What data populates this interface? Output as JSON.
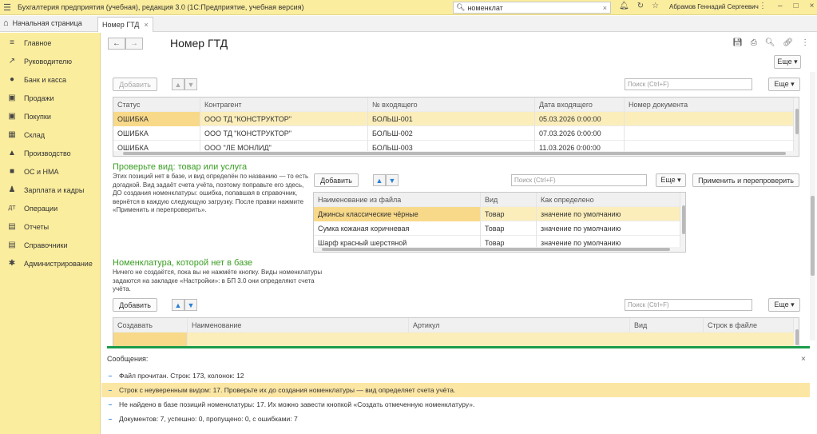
{
  "titlebar": {
    "app_title": "Бухгалтерия предприятия (учебная), редакция 3.0  (1С:Предприятие, учебная версия)",
    "search_value": "номенклат",
    "user": "Абрамов Геннадий Сергеевич"
  },
  "tabs": {
    "home": "Начальная страница",
    "doc": "Номер ГТД"
  },
  "sidebar": {
    "items": [
      {
        "label": "Главное",
        "icon": "≡"
      },
      {
        "label": "Руководителю",
        "icon": "↗"
      },
      {
        "label": "Банк и касса",
        "icon": "●"
      },
      {
        "label": "Продажи",
        "icon": "▣"
      },
      {
        "label": "Покупки",
        "icon": "▣"
      },
      {
        "label": "Склад",
        "icon": "▦"
      },
      {
        "label": "Производство",
        "icon": "▲"
      },
      {
        "label": "ОС и НМА",
        "icon": "■"
      },
      {
        "label": "Зарплата и кадры",
        "icon": "♟"
      },
      {
        "label": "Операции",
        "icon": "ДТ"
      },
      {
        "label": "Отчеты",
        "icon": "▤"
      },
      {
        "label": "Справочники",
        "icon": "▤"
      },
      {
        "label": "Администрирование",
        "icon": "✱"
      }
    ]
  },
  "doc": {
    "title": "Номер ГТД",
    "more": "Еще ▾",
    "add": "Добавить",
    "search_placeholder": "Поиск (Ctrl+F)",
    "top_grid": {
      "columns": [
        "Статус",
        "Контрагент",
        "№ входящего",
        "Дата входящего",
        "Номер документа"
      ],
      "rows": [
        [
          "ОШИБКА",
          "ООО ТД \"КОНСТРУКТОР\"",
          "БОЛЬШ-001",
          "05.03.2026 0:00:00",
          ""
        ],
        [
          "ОШИБКА",
          "ООО ТД \"КОНСТРУКТОР\"",
          "БОЛЬШ-002",
          "07.03.2026 0:00:00",
          ""
        ],
        [
          "ОШИБКА",
          "ООО \"ЛЕ МОНЛИД\"",
          "БОЛЬШ-003",
          "11.03.2026 0:00:00",
          ""
        ]
      ]
    },
    "section2": {
      "title": "Проверьте вид: товар или услуга",
      "note": "Этих позиций нет в базе, и вид определён по названию — то есть догадкой. Вид задаёт счета учёта, поэтому поправьте его здесь, ДО создания номенклатуры: ошибка, попавшая в справочник, вернётся в каждую следующую загрузку. После правки нажмите «Применить и перепроверить».",
      "apply": "Применить и перепроверить",
      "columns": [
        "Наименование из файла",
        "Вид",
        "Как определено"
      ],
      "rows": [
        [
          "Джинсы классические чёрные",
          "Товар",
          "значение по умолчанию"
        ],
        [
          "Сумка кожаная коричневая",
          "Товар",
          "значение по умолчанию"
        ],
        [
          "Шарф красный шерстяной",
          "Товар",
          "значение по умолчанию"
        ]
      ]
    },
    "section3": {
      "title": "Номенклатура, которой нет в базе",
      "note": "Ничего не создаётся, пока вы не нажмёте кнопку. Виды номенклатуры задаются на закладке «Настройки»: в БП 3.0 они определяют счета учёта.",
      "columns": [
        "Создавать",
        "Наименование",
        "Артикул",
        "Вид",
        "Строк в файле"
      ]
    }
  },
  "messages": {
    "title": "Сообщения:",
    "items": [
      "Файл прочитан. Строк: 173, колонок: 12",
      "Строк с неуверенным видом: 17. Проверьте их до создания номенклатуры — вид определяет счета учёта.",
      "Не найдено в базе позиций номенклатуры: 17. Их можно завести кнопкой «Создать отмеченную номенклатуру».",
      "Документов: 7, успешно: 0, пропущено: 0, с ошибками: 7"
    ]
  },
  "colors": {
    "accent_yellow": "#fbed9e",
    "selection": "#fbeebb",
    "green_heading": "#3a9d23",
    "message_bar": "#1c9c4a"
  }
}
